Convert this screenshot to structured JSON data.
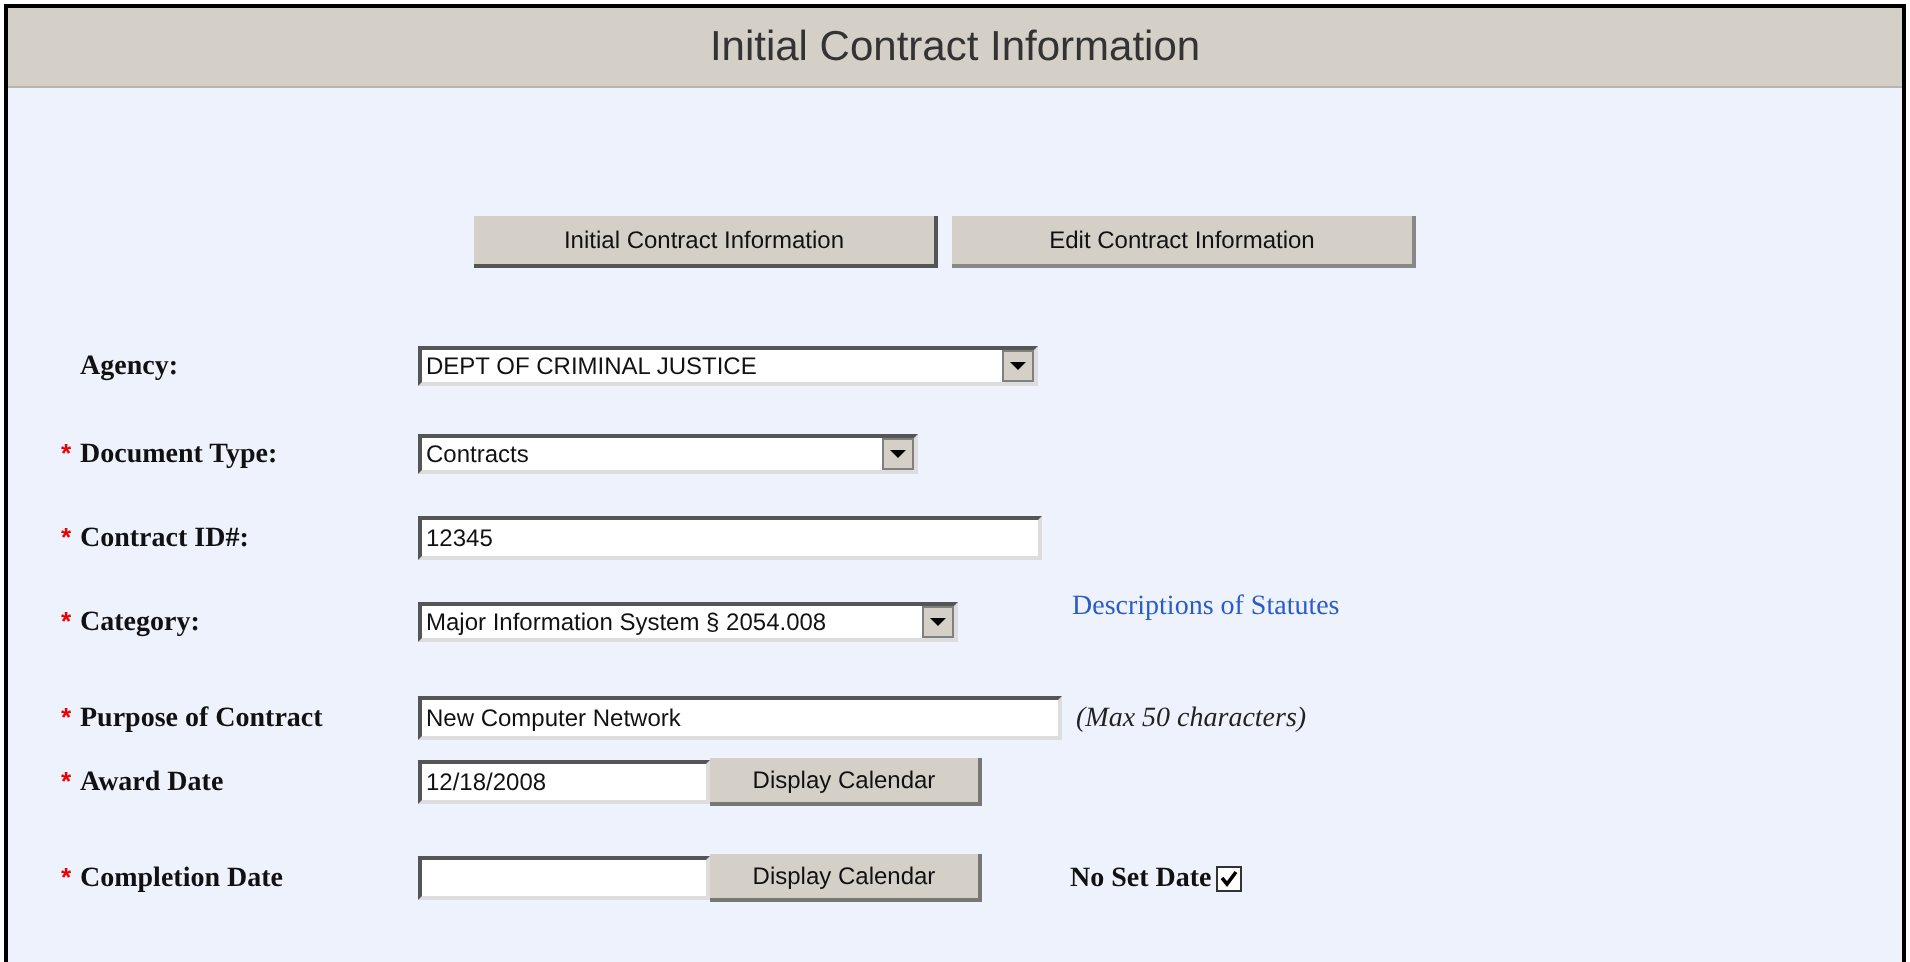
{
  "header": {
    "title": "Initial Contract Information"
  },
  "tabs": [
    {
      "label": "Initial Contract Information",
      "selected": true
    },
    {
      "label": "Edit Contract Information",
      "selected": false
    }
  ],
  "fields": [
    {
      "label": "Agency:",
      "kind": "select",
      "value": "DEPT OF CRIMINAL JUSTICE"
    },
    {
      "required_mark": "*",
      "label": "Document Type:",
      "kind": "select",
      "value": "Contracts"
    },
    {
      "required_mark": "*",
      "label": "Contract ID#:",
      "kind": "text",
      "value": "12345"
    },
    {
      "required_mark": "*",
      "label": "Category:",
      "kind": "select",
      "value": "Major Information System § 2054.008",
      "link": "Descriptions of Statutes"
    },
    {
      "required_mark": "*",
      "label": "Purpose of Contract",
      "kind": "text",
      "value": "New Computer Network",
      "note": "(Max 50 characters)"
    },
    {
      "required_mark": "*",
      "label": "Award Date",
      "kind": "date",
      "value": "12/18/2008",
      "button": "Display Calendar"
    },
    {
      "required_mark": "*",
      "label": "Completion Date",
      "kind": "date",
      "button": "Display Calendar",
      "checkbox": {
        "label": "No Set Date",
        "checked": true
      }
    }
  ]
}
